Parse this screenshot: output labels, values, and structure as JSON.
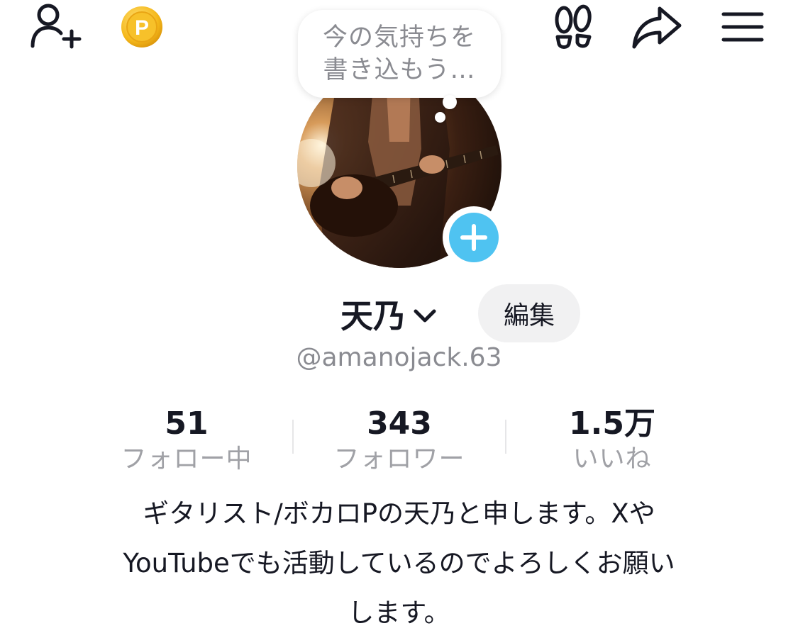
{
  "header": {
    "icons": {
      "add_friend": "add-friend-icon",
      "coin": "coin-icon",
      "footprint": "footprint-icon",
      "share": "share-icon",
      "menu": "menu-icon"
    },
    "coin_letter": "P"
  },
  "status_bubble": {
    "line1": "今の気持ちを",
    "line2": "書き込もう…"
  },
  "profile": {
    "name": "天乃",
    "edit_label": "編集",
    "username": "@amanojack.63"
  },
  "stats": {
    "following": {
      "value": "51",
      "label": "フォロー中"
    },
    "followers": {
      "value": "343",
      "label": "フォロワー"
    },
    "likes": {
      "value": "1.5万",
      "label": "いいね"
    }
  },
  "bio": {
    "line1": "ギタリスト/ボカロPの天乃と申します。Xや",
    "line2": "YouTubeでも活動しているのでよろしくお願い",
    "line3": "します。"
  },
  "colors": {
    "accent_blue": "#4fc3f1",
    "coin_gold": "#f5b81a",
    "text_primary": "#161823",
    "text_secondary": "#8a8b91"
  }
}
